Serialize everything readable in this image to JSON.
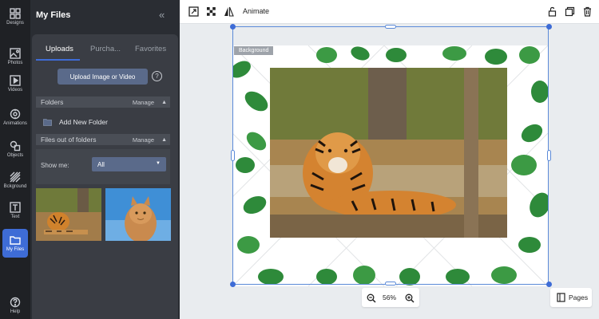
{
  "rail": {
    "items": [
      {
        "label": "Designs",
        "icon": "grid-icon"
      },
      {
        "label": "Photos",
        "icon": "image-icon"
      },
      {
        "label": "Videos",
        "icon": "video-icon"
      },
      {
        "label": "Animations",
        "icon": "animation-icon"
      },
      {
        "label": "Objects",
        "icon": "shapes-icon"
      },
      {
        "label": "Bckground",
        "icon": "stripes-icon"
      },
      {
        "label": "Text",
        "icon": "text-icon"
      },
      {
        "label": "My Files",
        "icon": "folder-icon",
        "active": true
      },
      {
        "label": "Help",
        "icon": "help-icon"
      }
    ]
  },
  "panel": {
    "title": "My Files",
    "tabs": [
      "Uploads",
      "Purcha...",
      "Favorites"
    ],
    "upload_button": "Upload Image or Video",
    "help_glyph": "?",
    "folders_section": {
      "title": "Folders",
      "manage": "Manage"
    },
    "add_folder": "Add New Folder",
    "files_section": {
      "title": "Files out of folders",
      "manage": "Manage"
    },
    "show_me_label": "Show me:",
    "show_me_value": "All"
  },
  "toolbar": {
    "animate_label": "Animate"
  },
  "canvas": {
    "background_badge": "Background",
    "zoom_value": "56%",
    "pages_label": "Pages"
  },
  "colors": {
    "accent": "#3e6cd6",
    "rail_bg": "#1f2125",
    "panel_bg": "#2a2d33"
  }
}
